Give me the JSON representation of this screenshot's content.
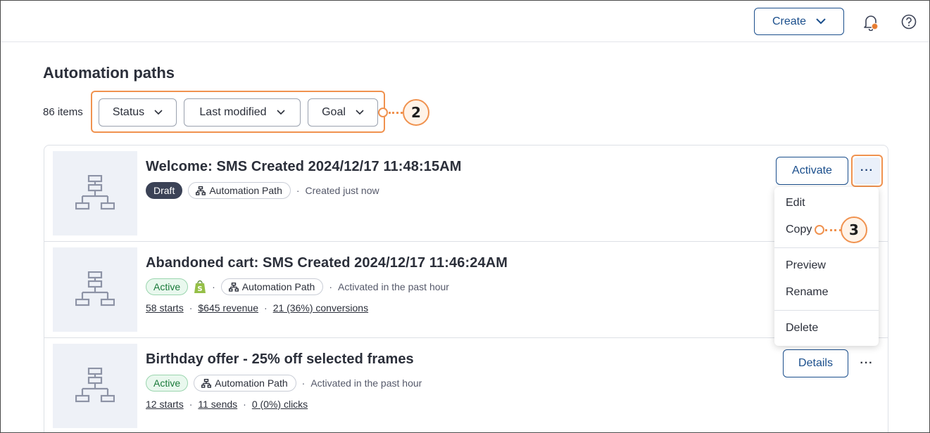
{
  "header": {
    "create_label": "Create",
    "bell_icon": "bell-icon",
    "help_icon": "help-icon"
  },
  "page": {
    "title": "Automation paths",
    "item_count": "86 items"
  },
  "filters": [
    {
      "label": "Status"
    },
    {
      "label": "Last modified"
    },
    {
      "label": "Goal"
    }
  ],
  "callouts": {
    "filters": "2",
    "copy": "3"
  },
  "rows": [
    {
      "title": "Welcome: SMS Created 2024/12/17 11:48:15AM",
      "status": "Draft",
      "type": "Automation Path",
      "time": "Created just now",
      "action": "Activate"
    },
    {
      "title": "Abandoned cart: SMS Created 2024/12/17 11:46:24AM",
      "status": "Active",
      "type": "Automation Path",
      "time": "Activated in the past hour",
      "stats": [
        "58 starts",
        "$645 revenue",
        "21 (36%) conversions"
      ]
    },
    {
      "title": "Birthday offer - 25% off selected frames",
      "status": "Active",
      "type": "Automation Path",
      "time": "Activated in the past hour",
      "stats": [
        "12 starts",
        "11 sends",
        "0 (0%) clicks"
      ],
      "action": "Details"
    }
  ],
  "menu": {
    "items": [
      "Edit",
      "Copy",
      "Preview",
      "Rename",
      "Delete"
    ]
  },
  "colors": {
    "accent": "#1a4e8c",
    "callout": "#f0924f",
    "draft": "#3b4256",
    "active": "#1a7a3a"
  }
}
